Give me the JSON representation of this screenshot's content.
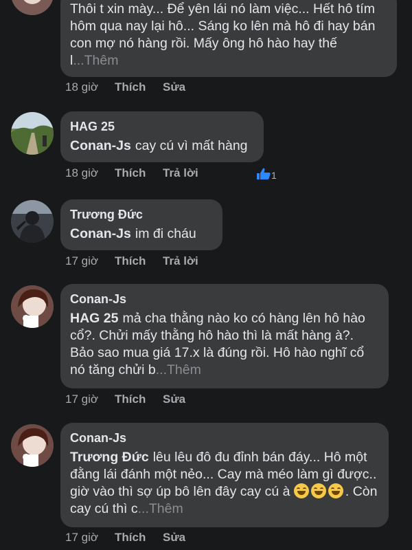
{
  "comments": [
    {
      "author": "",
      "mention": "",
      "text": "Thôi t xin mày... Để yên lái nó làm việc... Hết hô tím hôm qua nay lại hô... Sáng ko lên mà hô đi hay bán con mợ nó hàng rồi. Mấy ông hô hào hay thế l",
      "more": "...Thêm",
      "time": "18 giờ",
      "like": "Thích",
      "action2": "Sửa",
      "reaction_count": ""
    },
    {
      "author": "HAG 25",
      "mention": "Conan-Js",
      "text": "cay cú vì mất hàng",
      "more": "",
      "time": "18 giờ",
      "like": "Thích",
      "action2": "Trả lời",
      "reaction_count": "1"
    },
    {
      "author": "Trương Đức",
      "mention": "Conan-Js",
      "text": "im đi cháu",
      "more": "",
      "time": "17 giờ",
      "like": "Thích",
      "action2": "Trả lời",
      "reaction_count": ""
    },
    {
      "author": "Conan-Js",
      "mention": "HAG 25",
      "text": "mả cha thằng nào ko có hàng lên hô hào cổ?. Chửi mấy thằng hô hào thì là mất hàng à?. Bảo sao mua giá 17.x là đúng rồi. Hô hào nghĩ cổ nó tăng chửi b",
      "more": "...Thêm",
      "time": "17 giờ",
      "like": "Thích",
      "action2": "Sửa",
      "reaction_count": ""
    },
    {
      "author": "Conan-Js",
      "mention": "Trương Đức",
      "text": "lêu lêu đô đu đỉnh bán đáy... Hô một đằng lái đánh một nẻo... Cay mà méo làm gì được.. giờ vào thì sợ úp bô lên đây cay cú à",
      "text_after_emoji": ". Còn cay cú thì c",
      "more": "...Thêm",
      "time": "17 giờ",
      "like": "Thích",
      "action2": "Sửa",
      "reaction_count": ""
    }
  ],
  "icons": {
    "reaction": "like-thumbs-up-icon",
    "emoji": "grinning-face-emoji"
  },
  "colors": {
    "background": "#18191a",
    "bubble": "#3a3b3c",
    "text": "#e4e6eb",
    "muted": "#a8abaf",
    "like_blue": "#2d88ff"
  }
}
